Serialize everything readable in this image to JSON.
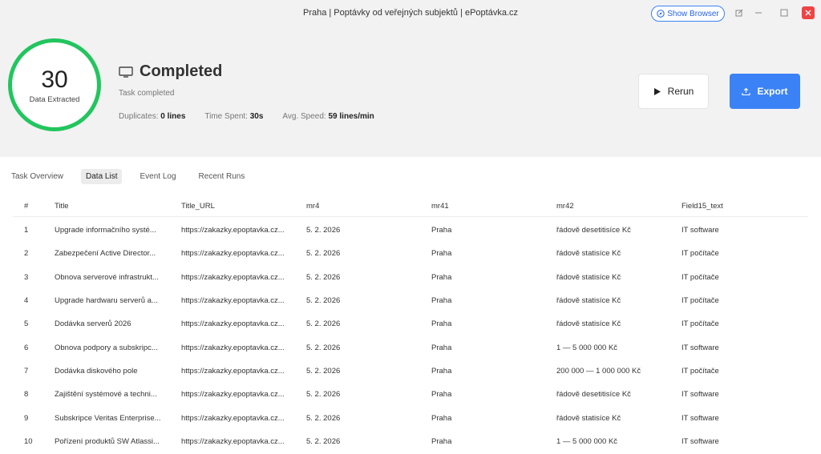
{
  "window": {
    "title": "Praha | Poptávky od veřejných subjektů | ePoptávka.cz",
    "show_browser": "Show Browser"
  },
  "summary": {
    "count": "30",
    "count_label": "Data Extracted",
    "status": "Completed",
    "status_sub": "Task completed",
    "duplicates_label": "Duplicates:",
    "duplicates_value": "0 lines",
    "time_label": "Time Spent:",
    "time_value": "30s",
    "speed_label": "Avg. Speed:",
    "speed_value": "59 lines/min"
  },
  "actions": {
    "rerun": "Rerun",
    "export": "Export"
  },
  "tabs": [
    {
      "label": "Task Overview"
    },
    {
      "label": "Data List"
    },
    {
      "label": "Event Log"
    },
    {
      "label": "Recent Runs"
    }
  ],
  "table": {
    "headers": [
      "#",
      "Title",
      "Title_URL",
      "mr4",
      "mr41",
      "mr42",
      "Field15_text"
    ],
    "rows": [
      [
        "1",
        "Upgrade informačního systé...",
        "https://zakazky.epoptavka.cz...",
        "5. 2. 2026",
        "Praha",
        "řádově desetitisíce Kč",
        "IT software"
      ],
      [
        "2",
        "Zabezpečení Active Director...",
        "https://zakazky.epoptavka.cz...",
        "5. 2. 2026",
        "Praha",
        "řádově statisíce Kč",
        "IT počítače"
      ],
      [
        "3",
        "Obnova serverové infrastrukt...",
        "https://zakazky.epoptavka.cz...",
        "5. 2. 2026",
        "Praha",
        "řádově statisíce Kč",
        "IT počítače"
      ],
      [
        "4",
        "Upgrade hardwaru serverů a...",
        "https://zakazky.epoptavka.cz...",
        "5. 2. 2026",
        "Praha",
        "řádově statisíce Kč",
        "IT počítače"
      ],
      [
        "5",
        "Dodávka serverů 2026",
        "https://zakazky.epoptavka.cz...",
        "5. 2. 2026",
        "Praha",
        "řádově statisíce Kč",
        "IT počítače"
      ],
      [
        "6",
        "Obnova podpory a subskripc...",
        "https://zakazky.epoptavka.cz...",
        "5. 2. 2026",
        "Praha",
        "1 — 5 000 000 Kč",
        "IT software"
      ],
      [
        "7",
        "Dodávka diskového pole",
        "https://zakazky.epoptavka.cz...",
        "5. 2. 2026",
        "Praha",
        "200 000 — 1 000 000 Kč",
        "IT počítače"
      ],
      [
        "8",
        "Zajištění systémové a techni...",
        "https://zakazky.epoptavka.cz...",
        "5. 2. 2026",
        "Praha",
        "řádově desetitisíce Kč",
        "IT software"
      ],
      [
        "9",
        "Subskripce Veritas Enterprise...",
        "https://zakazky.epoptavka.cz...",
        "5. 2. 2026",
        "Praha",
        "řádově statisíce Kč",
        "IT software"
      ],
      [
        "10",
        "Pořízení produktů SW Atlassi...",
        "https://zakazky.epoptavka.cz...",
        "5. 2. 2026",
        "Praha",
        "1 — 5 000 000 Kč",
        "IT software"
      ]
    ]
  },
  "colors": {
    "accent": "#3b82f6",
    "success": "#22c55e",
    "close": "#ef4444"
  }
}
